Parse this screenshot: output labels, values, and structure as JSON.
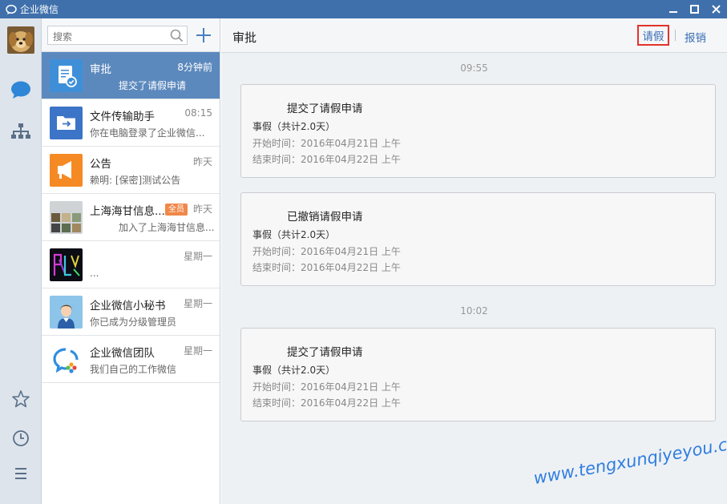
{
  "window": {
    "title": "企业微信"
  },
  "search": {
    "placeholder": "搜索"
  },
  "conversations": [
    {
      "name": "审批",
      "time": "8分钟前",
      "preview": "提交了请假申请",
      "active": true
    },
    {
      "name": "文件传输助手",
      "time": "08:15",
      "preview": "你在电脑登录了企业微信..."
    },
    {
      "name": "公告",
      "time": "昨天",
      "preview": "赖明: [保密]测试公告"
    },
    {
      "name": "上海海甘信息...",
      "badge": "全员",
      "time": "昨天",
      "preview": "加入了上海海甘信息..."
    },
    {
      "name": "",
      "time": "星期一",
      "preview": "..."
    },
    {
      "name": "企业微信小秘书",
      "time": "星期一",
      "preview": "你已成为分级管理员"
    },
    {
      "name": "企业微信团队",
      "time": "星期一",
      "preview": "我们自己的工作微信"
    }
  ],
  "main": {
    "title": "审批",
    "actions": {
      "leave": "请假",
      "reimburse": "报销"
    },
    "timestamps": [
      "09:55",
      "10:02"
    ],
    "cards": [
      {
        "title": "提交了请假申请",
        "type": "事假（共计2.0天）",
        "start": "开始时间：2016年04月21日 上午",
        "end": "结束时间：2016年04月22日 上午"
      },
      {
        "title": "已撤销请假申请",
        "type": "事假（共计2.0天）",
        "start": "开始时间：2016年04月21日 上午",
        "end": "结束时间：2016年04月22日 上午"
      },
      {
        "title": "提交了请假申请",
        "type": "事假（共计2.0天）",
        "start": "开始时间：2016年04月21日 上午",
        "end": "结束时间：2016年04月22日 上午"
      }
    ]
  },
  "watermark": "www.tengxunqiyeyou.com",
  "colors": {
    "titlebar": "#3f70ac",
    "active_item": "#5c89bd",
    "accent_link": "#3b6fb5",
    "highlight_border": "#e2332a"
  }
}
